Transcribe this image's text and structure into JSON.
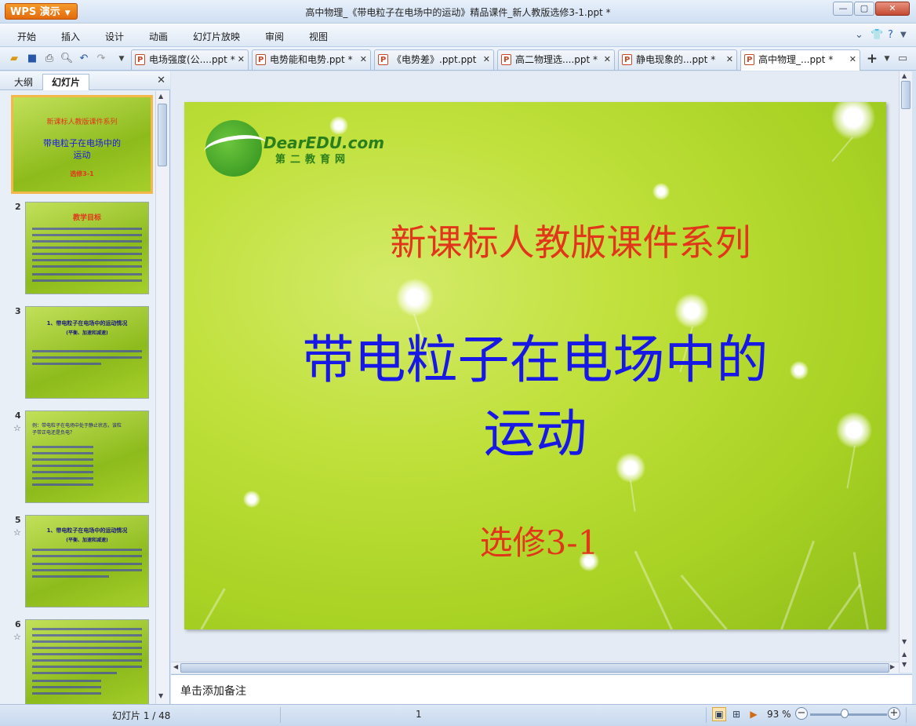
{
  "app": {
    "logo": "WPS 演示",
    "title": "高中物理_《带电粒子在电场中的运动》精品课件_新人教版选修3-1.ppt *"
  },
  "menu": [
    "开始",
    "插入",
    "设计",
    "动画",
    "幻灯片放映",
    "审阅",
    "视图"
  ],
  "tabs": [
    {
      "label": "电场强度(公....ppt *"
    },
    {
      "label": "电势能和电势.ppt *"
    },
    {
      "label": "《电势差》.ppt.ppt"
    },
    {
      "label": "高二物理选....ppt *"
    },
    {
      "label": "静电现象的...ppt *"
    },
    {
      "label": "高中物理_...ppt *"
    }
  ],
  "panel": {
    "tab_outline": "大纲",
    "tab_slides": "幻灯片"
  },
  "thumbnails": [
    {
      "num": "1",
      "l1": "新课标人教版课件系列",
      "l2": "带电粒子在电场中的",
      "l3": "运动",
      "l4": "选修3-1"
    },
    {
      "num": "2",
      "title": "教学目标"
    },
    {
      "num": "3",
      "title": "1、带电粒子在电场中的运动情况",
      "sub": "(平衡、加速和减速)"
    },
    {
      "num": "4",
      "title": "例：带电粒子在电场中处于静止状态，该粒子带正电还是负电？"
    },
    {
      "num": "5",
      "title": "1、带电粒子在电场中的运动情况",
      "sub": "(平衡、加速和减速)"
    },
    {
      "num": "6",
      "title": ""
    }
  ],
  "slide": {
    "logo_text": "DearEDU.com",
    "logo_sub": "第二教育网",
    "title1": "新课标人教版课件系列",
    "title2_line1": "带电粒子在电场中的",
    "title2_line2": "运动",
    "title3": "选修3-1"
  },
  "notes_placeholder": "单击添加备注",
  "status": {
    "slide_counter": "幻灯片 1 / 48",
    "page": "1",
    "zoom": "93 %"
  },
  "colors": {
    "slide_red": "#e2361a",
    "slide_blue": "#1818e6",
    "accent_orange": "#e36b0d"
  }
}
